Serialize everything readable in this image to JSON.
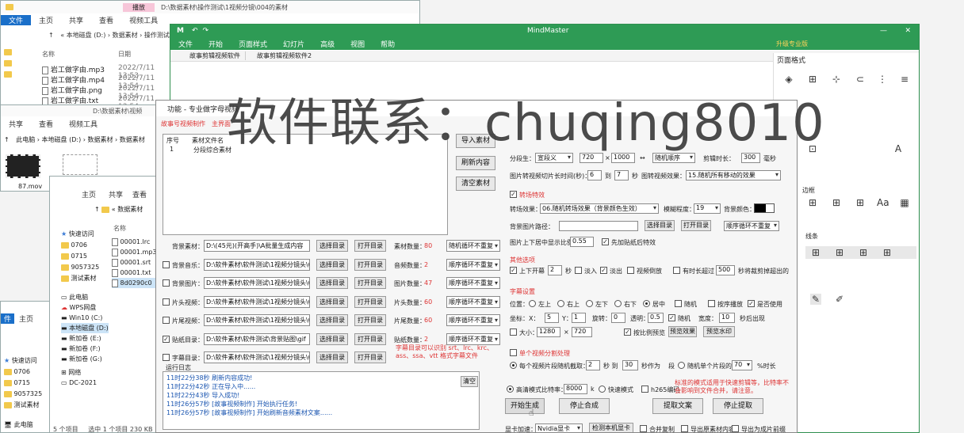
{
  "explorer1": {
    "path": "D:\\数据素材\\操作测试\\1视频分镜\\004的素材",
    "tabs": [
      "文件",
      "主页",
      "共享",
      "查看",
      "视频工具"
    ],
    "manage": "播放",
    "breadcrumb": "« 本地磁盘 (D:) › 数据素材 › 操作测试",
    "col_name": "名称",
    "col_date": "日期",
    "files": [
      {
        "name": "岩工做字由.mp3",
        "date": "2022/7/11 13:53"
      },
      {
        "name": "岩工做字由.mp4",
        "date": "2022/7/11 13:54"
      },
      {
        "name": "岩工做字由.png",
        "date": "2022/7/11 13:54"
      },
      {
        "name": "岩工做字由.txt",
        "date": "2022/7/11 13:54"
      }
    ]
  },
  "explorer2": {
    "path": "D:\\数据素材\\视频",
    "tabs": [
      "共享",
      "查看",
      "视频工具"
    ],
    "breadcrumb": [
      "此电脑",
      "本地磁盘 (D:)",
      "数据素材",
      "数据素材"
    ],
    "thumb_label": "87.mov"
  },
  "explorer3": {
    "tabs": [
      "主页",
      "共享",
      "查看"
    ],
    "breadcrumb": "« 数据素材",
    "nav": [
      "快速访问",
      "0706",
      "0715",
      "9057325",
      "测试素材"
    ],
    "col_name": "名称",
    "files": [
      "00001.lrc",
      "00001.mp3",
      "00001.srt",
      "00001.txt",
      "8d0290c0"
    ],
    "pc_items": [
      "此电脑",
      "WPS网盘",
      "Win10 (C:)",
      "本地磁盘 (D:)",
      "新加卷 (E:)",
      "新加卷 (F:)",
      "新加卷 (G:)",
      "网络",
      "DC-2021"
    ],
    "status": "5 个项目",
    "status2": "选中 1 个项目  230 KB"
  },
  "explorer4": {
    "tabs": [
      "件",
      "主页"
    ],
    "nav": [
      "快速访问",
      "0706",
      "0715",
      "9057325",
      "测试素材"
    ],
    "pc": "此电脑"
  },
  "mindmaster": {
    "title": "MindMaster",
    "menu": [
      "文件",
      "开始",
      "页面样式",
      "幻灯片",
      "高级",
      "视图",
      "帮助"
    ],
    "upgrade": "升级专业版",
    "tabs": [
      "故事剪辑视频软件",
      "故事剪辑视频软件2"
    ],
    "panel_title": "页面格式",
    "panel_labels": [
      "边框",
      "线条"
    ]
  },
  "tool": {
    "title": "功能 - 专业做字母视频",
    "tabs": [
      "故事号视频制作",
      "主界面"
    ],
    "list_headers": [
      "序号",
      "素材文件名"
    ],
    "list_row": {
      "idx": "1",
      "name": "分段综合素材"
    },
    "btn_import": "导入素材",
    "btn_refresh": "刷新内容",
    "btn_clear": "清空素材",
    "rows": [
      {
        "checked": false,
        "label": "背景素材：",
        "path": "D:\\(45元)(开高手)\\A批量生成内容",
        "b1": "选择目录",
        "b2": "打开目录",
        "count_label": "素材数量：",
        "count": "80",
        "mode": "随机循环不重复"
      },
      {
        "checked": false,
        "label": "背景音乐：",
        "path": "D:\\软件素材\\软件测试\\1视频分镜头\\0",
        "b1": "选择目录",
        "b2": "打开目录",
        "count_label": "音频数量：",
        "count": "2",
        "mode": "顺序循环不重复"
      },
      {
        "checked": false,
        "label": "背景图片：",
        "path": "D:\\软件素材\\软件测试\\1视频分镜头\\0",
        "b1": "选择目录",
        "b2": "打开目录",
        "count_label": "图片数量：",
        "count": "47",
        "mode": "顺序循环不重复"
      },
      {
        "checked": false,
        "label": "片头视频：",
        "path": "D:\\软件素材\\软件测试\\1视频分镜头\\0",
        "b1": "选择目录",
        "b2": "打开目录",
        "count_label": "片头数量：",
        "count": "60",
        "mode": "顺序循环不重复"
      },
      {
        "checked": false,
        "label": "片尾视频：",
        "path": "D:\\软件素材\\软件测试\\1视频分镜头\\0",
        "b1": "选择目录",
        "b2": "打开目录",
        "count_label": "片尾数量：",
        "count": "60",
        "mode": "顺序循环不重复"
      },
      {
        "checked": true,
        "label": "贴纸目录：",
        "path": "D:\\软件素材\\软件测试\\背景贴图\\gif",
        "b1": "选择目录",
        "b2": "打开目录",
        "count_label": "贴纸数量：",
        "count": "2",
        "mode": "顺序循环不重复"
      },
      {
        "checked": false,
        "label": "字幕目录：",
        "path": "D:\\软件素材\\软件测试\\1视频分镜头\\0",
        "b1": "选择目录",
        "b2": "打开目录",
        "count_label": "",
        "count": "",
        "mode": ""
      }
    ],
    "subtitle_hint": "字幕目录可以识别 srt、lrc、krc、ass、ssa、vtt 格式字幕文件",
    "log_label": "运行日志",
    "log_clear": "清空",
    "log": [
      "11时22分38秒 刷新内容成功!",
      "11时22分42秒 正在导入中......",
      "11时22分43秒 导入成功!",
      "11时26分57秒 [故事视频制作] 开始执行任务!",
      "11时26分57秒 [故事视频制作] 开始刷新音频素材文案......"
    ],
    "right": {
      "r1_labels": [
        "分段生：",
        "宣段义",
        "720",
        "×",
        "1000",
        "↔",
        "随机顺序",
        "剪辑时长：",
        "300",
        "毫秒"
      ],
      "r2_label": "图片转视频切片长时间(秒)：",
      "r2_v1": "6",
      "r2_to": "到",
      "r2_v2": "7",
      "r2_unit": "秒",
      "r2_sel_label": "图转视频效果：",
      "r2_sel": "15.随机所有移动的效果",
      "section_trans": "转场特效",
      "trans_label": "转场效果：",
      "trans_sel": "06.随机转场效果（背景颜色生效）",
      "trans_strength_label": "模糊程度：",
      "trans_strength": "19",
      "bg_color_label": "背景颜色：",
      "bg_img_label": "背景图片路径：",
      "bg_btn1": "选择目录",
      "bg_btn2": "打开目录",
      "bg_mode": "顺序循环不重复",
      "ratio_label": "图片上下居中显示比例：",
      "ratio": "0.55",
      "ratio_chk": "先加贴纸后特效",
      "section_other": "其他选项",
      "other_items": [
        "上下开幕",
        "2",
        "秒",
        "淡入",
        "淡出",
        "视频倒放",
        "有时长超过",
        "500",
        "秒将裁剪掉超出的"
      ],
      "section_sub": "字幕设置",
      "pos_label": "位置：",
      "positions": [
        "左上",
        "右上",
        "左下",
        "右下",
        "居中",
        "随机",
        "按序播放",
        "是否使用"
      ],
      "xy": [
        "坐标：X：",
        "5",
        "Y：",
        "1",
        "旋转：",
        "0",
        "透明：",
        "0.5",
        "随机",
        "宽度：",
        "10",
        "秒后出现"
      ],
      "size_label": "大小：",
      "size_w": "1280",
      "size_x": "×",
      "size_h": "720",
      "size_chk": "按比例预览",
      "size_btn": "预览效果",
      "preview_btn": "预览水印",
      "section_cut": "单个视频分割处理",
      "cut_label": "每个视频片段随机截取：",
      "cut_v1": "2",
      "cut_to": "秒 到",
      "cut_v2": "30",
      "cut_unit": "秒作为",
      "cut_mode": "段",
      "cut_pct_label": "随机单个片段的",
      "cut_pct": "70",
      "cut_pct_unit": "%时长",
      "mode_opts": [
        "高清模式",
        "快速模式",
        "h265编码"
      ],
      "bitrate_label": "比特率：",
      "bitrate": "8000",
      "bitrate_unit": "k",
      "tip": "标准的模式适用于快速剪辑等，比特率不会影响到文件合并，请注意。",
      "btn_start": "开始生成",
      "btn_merge": "停止合成",
      "btn_extract": "提取文案",
      "btn_stop": "停止提取",
      "gpu_label": "显卡加速：",
      "gpu_sel": "Nvidia显卡",
      "gpu_btn": "检测本机显卡",
      "opt_a": "合并复制",
      "opt_b": "导出原素材内容",
      "opt_c": "导出为成片前缀"
    }
  },
  "watermark": "软件联系：chuqing8010"
}
